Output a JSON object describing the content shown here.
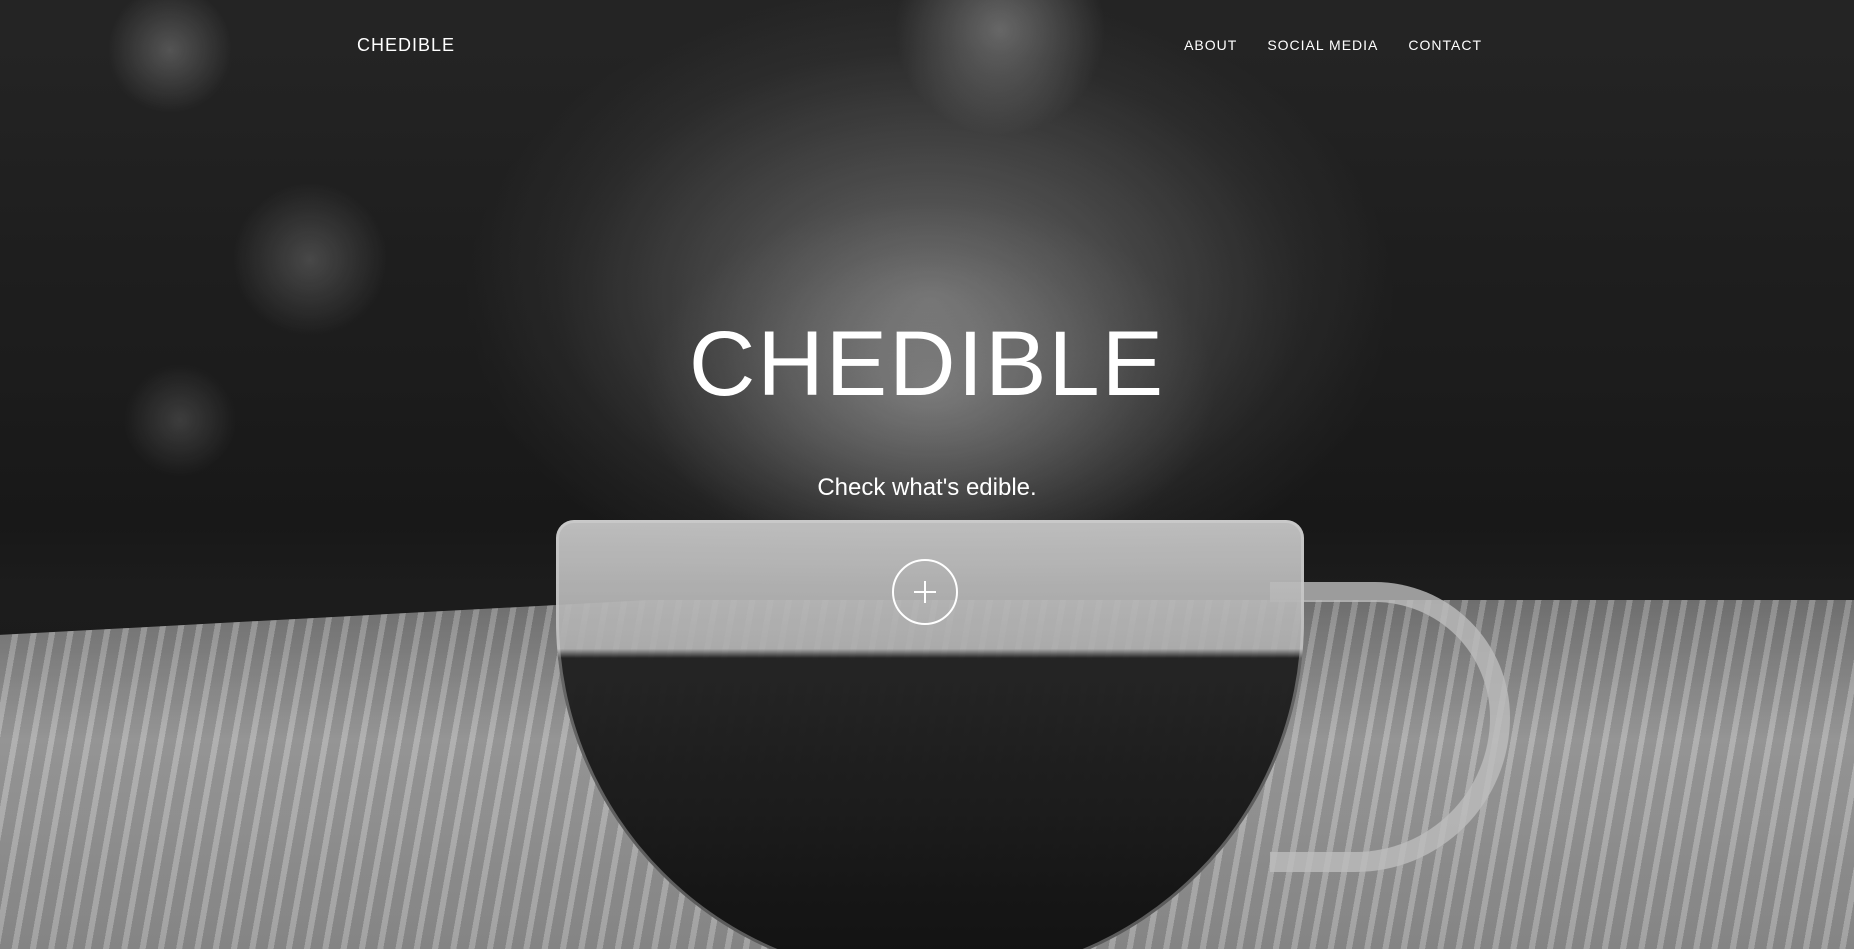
{
  "header": {
    "brand": "CHEDIBLE",
    "menu": [
      {
        "label": "ABOUT"
      },
      {
        "label": "SOCIAL MEDIA"
      },
      {
        "label": "CONTACT"
      }
    ]
  },
  "hero": {
    "title": "CHEDIBLE",
    "subtitle": "Check what's edible.",
    "action_icon": "plus-icon",
    "background": "black-and-white photo of a steaming glass cup of tea on a table"
  },
  "colors": {
    "text": "#ffffff",
    "background_dark": "#1b1b1b"
  }
}
